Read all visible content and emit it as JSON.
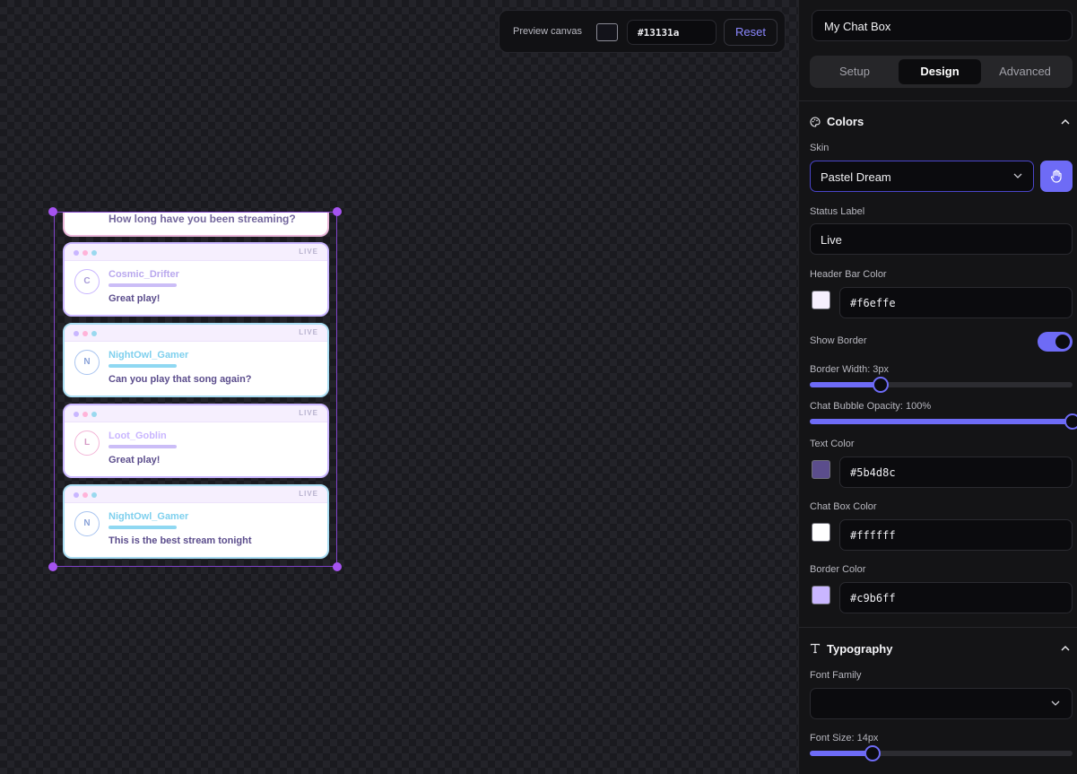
{
  "preview": {
    "label": "Preview canvas",
    "canvas_color": "#13131a",
    "reset_label": "Reset"
  },
  "chat": {
    "partial_message": "How long have you been streaming?",
    "status_label": "Live",
    "messages": [
      {
        "initial": "C",
        "username": "Cosmic_Drifter",
        "text": "Great play!",
        "status": "LIVE"
      },
      {
        "initial": "N",
        "username": "NightOwl_Gamer",
        "text": "Can you play that song again?",
        "status": "LIVE"
      },
      {
        "initial": "L",
        "username": "Loot_Goblin",
        "text": "Great play!",
        "status": "LIVE"
      },
      {
        "initial": "N",
        "username": "NightOwl_Gamer",
        "text": "This is the best stream tonight",
        "status": "LIVE"
      }
    ]
  },
  "panel": {
    "name_value": "My Chat Box",
    "tabs": [
      "Setup",
      "Design",
      "Advanced"
    ],
    "active_tab": "Design",
    "colors": {
      "title": "Colors",
      "skin_label": "Skin",
      "skin_value": "Pastel Dream",
      "status_label_label": "Status Label",
      "status_label_value": "Live",
      "header_bar_color_label": "Header Bar Color",
      "header_bar_color": "#f6effe",
      "show_border_label": "Show Border",
      "show_border_on": true,
      "border_width_label": "Border Width: 3px",
      "border_width_fraction": 0.27,
      "bubble_opacity_label": "Chat Bubble Opacity: 100%",
      "bubble_opacity_fraction": 1.0,
      "text_color_label": "Text Color",
      "text_color": "#5b4d8c",
      "chat_box_color_label": "Chat Box Color",
      "chat_box_color": "#ffffff",
      "border_color_label": "Border Color",
      "border_color": "#c9b6ff"
    },
    "typography": {
      "title": "Typography",
      "font_family_label": "Font Family",
      "font_family_value": "",
      "font_size_label": "Font Size: 14px",
      "font_size_fraction": 0.24
    }
  },
  "icons": {
    "colors_section": "palette-icon",
    "typography_section": "text-type-icon",
    "skin_action": "hand-icon",
    "collapse": "chevron-up-icon",
    "dropdown": "chevron-down-icon"
  },
  "theme": {
    "accent": "#6e6bf6",
    "selection": "#a553f0"
  }
}
